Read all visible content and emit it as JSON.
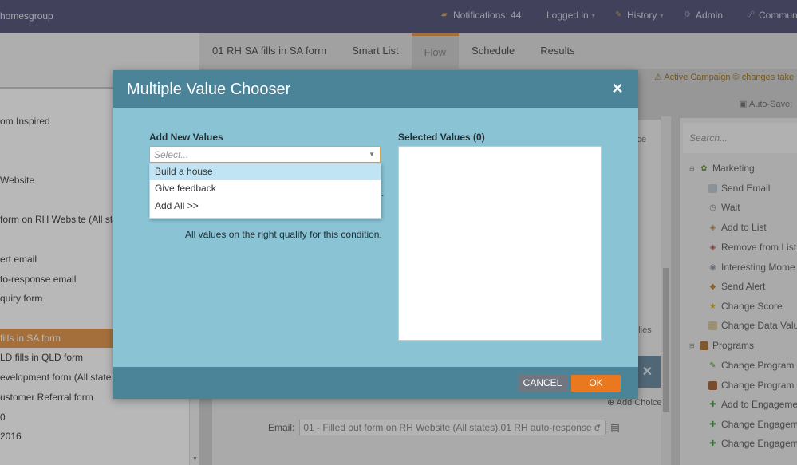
{
  "topbar": {
    "brand": "homesgroup",
    "notifications": "Notifications: 44",
    "logged_in": "Logged in",
    "history": "History",
    "admin": "Admin",
    "community": "Commun"
  },
  "left_tree": {
    "items": [
      "om Inspired",
      "Website",
      "form on RH Website (All sta",
      "ert email",
      "to-response email",
      "quiry form",
      "fills in SA form",
      "LD fills in QLD form",
      "evelopment form (All state",
      "ustomer Referral form",
      "0",
      "2016"
    ]
  },
  "tabs": [
    "01 RH SA fills in SA form",
    "Smart List",
    "Flow",
    "Schedule",
    "Results"
  ],
  "main": {
    "warning": "Active Campaign © changes take",
    "autosave": "Auto-Save:",
    "ghost_choice_1": "oice",
    "ghost_choice_2": "oplies",
    "add_choice": "Add Choice",
    "email_label": "Email:",
    "email_value": "01 - Filled out form on RH Website (All states).01 RH auto-response e"
  },
  "palette": {
    "search_placeholder": "Search...",
    "groups": [
      {
        "label": "Marketing",
        "items": [
          "Send Email",
          "Wait",
          "Add to List",
          "Remove from List",
          "Interesting Mome",
          "Send Alert",
          "Change Score",
          "Change Data Valu"
        ]
      },
      {
        "label": "Programs",
        "items": [
          "Change Program S",
          "Change Program S",
          "Add to Engageme",
          "Change Engageme",
          "Change Engageme"
        ]
      }
    ]
  },
  "dialog": {
    "title": "Multiple Value Chooser",
    "add_new_label": "Add New Values",
    "select_placeholder": "Select...",
    "options": [
      "Build a house",
      "Give feedback",
      "Add All >>"
    ],
    "selected_label": "Selected Values (0)",
    "qualify_text": "All values on the right qualify for this condition.",
    "cancel": "CANCEL",
    "ok": "OK"
  },
  "colors": {
    "topbar": "#5a5b80",
    "dialog_header": "#4b8399",
    "dialog_body": "#89c3d4",
    "accent_orange": "#e9781f",
    "option_highlight": "#c1e4f5"
  }
}
